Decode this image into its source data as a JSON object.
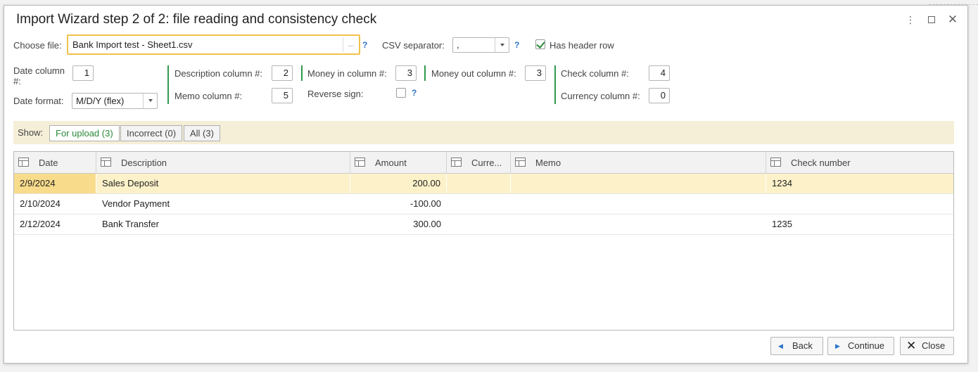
{
  "window": {
    "title": "Import Wizard step 2 of 2: file reading and consistency check",
    "more_icon": "⋮",
    "close_icon": "✕"
  },
  "file": {
    "label": "Choose file:",
    "value": "Bank Import test - Sheet1.csv",
    "browse": "...",
    "help": "?"
  },
  "csv": {
    "label": "CSV separator:",
    "value": ",",
    "help": "?"
  },
  "header_row": {
    "label": "Has header row",
    "checked": true
  },
  "columns": {
    "date_label": "Date column #:",
    "date_value": "1",
    "date_format_label": "Date format:",
    "date_format_value": "M/D/Y (flex)",
    "description_label": "Description column #:",
    "description_value": "2",
    "memo_label": "Memo column #:",
    "memo_value": "5",
    "money_in_label": "Money in column #:",
    "money_in_value": "3",
    "reverse_sign_label": "Reverse sign:",
    "reverse_sign_help": "?",
    "money_out_label": "Money out column #:",
    "money_out_value": "3",
    "check_label": "Check column #:",
    "check_value": "4",
    "currency_label": "Currency column #:",
    "currency_value": "0"
  },
  "show": {
    "label": "Show:",
    "options": [
      "For upload (3)",
      "Incorrect (0)",
      "All (3)"
    ],
    "active": 0
  },
  "table": {
    "headers": [
      "Date",
      "Description",
      "Amount",
      "Curre...",
      "Memo",
      "Check number"
    ],
    "rows": [
      {
        "date": "2/9/2024",
        "description": "Sales Deposit",
        "amount": "200.00",
        "currency": "",
        "memo": "",
        "check": "1234"
      },
      {
        "date": "2/10/2024",
        "description": "Vendor Payment",
        "amount": "-100.00",
        "currency": "",
        "memo": "",
        "check": ""
      },
      {
        "date": "2/12/2024",
        "description": "Bank Transfer",
        "amount": "300.00",
        "currency": "",
        "memo": "",
        "check": "1235"
      }
    ]
  },
  "buttons": {
    "back": "Back",
    "continue": "Continue",
    "close": "Close"
  },
  "colors": {
    "accent_green": "#2a8a3a",
    "help_blue": "#2b73c9",
    "highlight_row": "#fcf1c9",
    "file_border": "#f0c14b"
  }
}
